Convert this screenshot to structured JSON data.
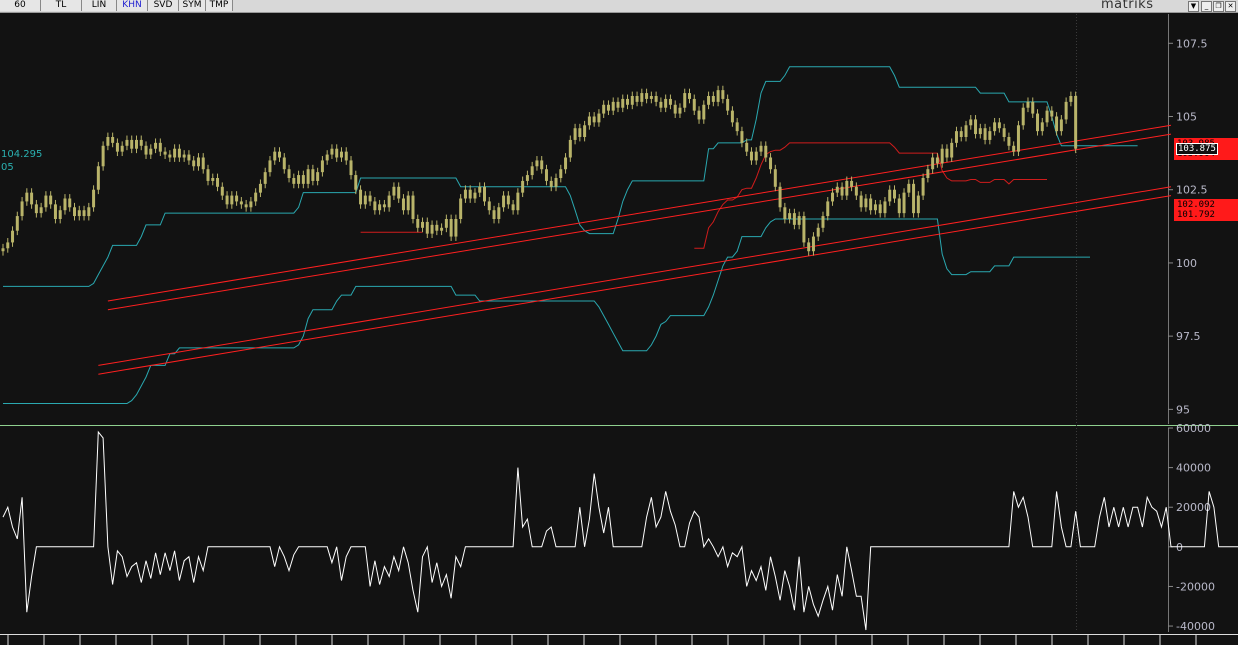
{
  "toolbar": {
    "buttons": [
      {
        "label": "60",
        "active": false
      },
      {
        "label": "TL",
        "active": false
      },
      {
        "label": "LIN",
        "active": false
      },
      {
        "label": "KHN",
        "active": true
      },
      {
        "label": "SVD",
        "active": false
      },
      {
        "label": "SYM",
        "active": false
      },
      {
        "label": "TMP",
        "active": false
      }
    ],
    "brand": "matriks",
    "controls": {
      "dropdown": "▼",
      "minimize": "_",
      "restore": "❐",
      "close": "✕"
    }
  },
  "colors": {
    "background": "#121212",
    "candle": "#b9b46a",
    "upper_band": "#2aa8b0",
    "mid_line": "#d01c1c",
    "trend_lines": "#ff2020",
    "oscillator": "#ffffff",
    "axis_text": "#b8b8c8",
    "price_tag": "#ff1a1a"
  },
  "left_labels": {
    "band_value": "104.295",
    "band_value_2": "05"
  },
  "price_tags": [
    {
      "top": "103.985",
      "bottom": "103.904",
      "current": "103.875"
    },
    {
      "top": "102.092",
      "bottom": "101.792"
    }
  ],
  "chart_data": [
    {
      "type": "candlestick",
      "title": "",
      "yticks": [
        "107.5",
        "105",
        "102.5",
        "100",
        "97.5",
        "95"
      ],
      "ylim": [
        94.5,
        108.5
      ],
      "closes": [
        100.5,
        100.7,
        101.1,
        101.6,
        102.1,
        102.4,
        102.0,
        101.7,
        101.9,
        102.3,
        102.0,
        101.5,
        101.8,
        102.2,
        101.9,
        101.6,
        101.8,
        101.6,
        101.9,
        102.5,
        103.3,
        104.0,
        104.3,
        104.1,
        103.8,
        104.0,
        104.2,
        103.9,
        104.2,
        104.0,
        103.7,
        103.9,
        104.1,
        103.8,
        103.7,
        103.6,
        103.9,
        103.6,
        103.7,
        103.5,
        103.3,
        103.6,
        103.2,
        102.8,
        102.9,
        102.6,
        102.3,
        102.0,
        102.3,
        102.1,
        102.0,
        101.9,
        102.1,
        102.4,
        102.7,
        103.1,
        103.5,
        103.8,
        103.6,
        103.2,
        102.9,
        102.7,
        103.0,
        102.7,
        103.2,
        102.8,
        103.1,
        103.5,
        103.7,
        103.9,
        103.6,
        103.8,
        103.5,
        103.0,
        102.5,
        102.0,
        102.3,
        102.1,
        101.8,
        102.0,
        101.9,
        102.3,
        102.6,
        102.2,
        101.8,
        102.3,
        101.5,
        101.2,
        101.4,
        101.0,
        101.3,
        101.1,
        101.2,
        101.5,
        100.9,
        101.5,
        102.2,
        102.5,
        102.2,
        102.4,
        102.6,
        102.1,
        101.8,
        101.5,
        101.9,
        102.3,
        102.0,
        101.8,
        102.4,
        102.8,
        103.0,
        103.3,
        103.5,
        103.2,
        102.8,
        102.6,
        102.9,
        103.2,
        103.6,
        104.2,
        104.6,
        104.3,
        104.7,
        105.0,
        104.8,
        105.1,
        105.4,
        105.2,
        105.5,
        105.3,
        105.6,
        105.4,
        105.7,
        105.5,
        105.8,
        105.6,
        105.7,
        105.5,
        105.3,
        105.6,
        105.4,
        105.1,
        105.3,
        105.8,
        105.6,
        105.2,
        104.9,
        105.4,
        105.7,
        105.5,
        105.9,
        105.6,
        105.2,
        104.8,
        104.5,
        104.1,
        103.8,
        103.5,
        103.8,
        104.0,
        103.6,
        103.2,
        102.6,
        101.9,
        101.5,
        101.7,
        101.3,
        101.6,
        100.7,
        100.4,
        100.9,
        101.2,
        101.6,
        102.1,
        102.4,
        102.6,
        102.3,
        102.8,
        102.6,
        102.3,
        101.9,
        102.2,
        101.8,
        102.0,
        101.7,
        102.1,
        102.5,
        102.2,
        101.7,
        102.4,
        102.7,
        101.7,
        102.3,
        102.9,
        103.2,
        103.6,
        103.4,
        103.9,
        103.6,
        104.1,
        104.5,
        104.3,
        104.7,
        104.9,
        104.4,
        104.6,
        104.2,
        104.5,
        104.8,
        104.6,
        104.3,
        104.0,
        103.8,
        104.7,
        105.3,
        105.5,
        105.1,
        104.5,
        104.8,
        105.2,
        105.0,
        104.5,
        104.9,
        105.5,
        105.7,
        103.9
      ],
      "upper_band": [
        99.2,
        99.2,
        99.2,
        99.2,
        99.2,
        99.2,
        99.2,
        99.2,
        99.2,
        99.2,
        99.2,
        99.2,
        99.2,
        99.2,
        99.2,
        99.2,
        99.2,
        99.2,
        99.2,
        99.3,
        99.6,
        99.9,
        100.2,
        100.6,
        100.6,
        100.6,
        100.6,
        100.6,
        100.6,
        100.9,
        101.3,
        101.3,
        101.3,
        101.3,
        101.7,
        101.7,
        101.7,
        101.7,
        101.7,
        101.7,
        101.7,
        101.7,
        101.7,
        101.7,
        101.7,
        101.7,
        101.7,
        101.7,
        101.7,
        101.7,
        101.7,
        101.7,
        101.7,
        101.7,
        101.7,
        101.7,
        101.7,
        101.7,
        101.7,
        101.7,
        101.7,
        101.7,
        101.9,
        102.4,
        102.4,
        102.4,
        102.4,
        102.4,
        102.4,
        102.4,
        102.4,
        102.4,
        102.4,
        102.4,
        102.4,
        102.9,
        102.9,
        102.9,
        102.9,
        102.9,
        102.9,
        102.9,
        102.9,
        102.9,
        102.9,
        102.9,
        102.9,
        102.9,
        102.9,
        102.9,
        102.9,
        102.9,
        102.9,
        102.9,
        102.9,
        102.9,
        102.6,
        102.6,
        102.6,
        102.6,
        102.6,
        102.6,
        102.6,
        102.6,
        102.6,
        102.6,
        102.6,
        102.6,
        102.6,
        102.6,
        102.6,
        102.6,
        102.6,
        102.6,
        102.6,
        102.6,
        102.6,
        102.6,
        102.6,
        102.3,
        101.8,
        101.3,
        101.1,
        101.0,
        101.0,
        101.0,
        101.0,
        101.0,
        101.0,
        101.5,
        102.1,
        102.5,
        102.8,
        102.8,
        102.8,
        102.8,
        102.8,
        102.8,
        102.8,
        102.8,
        102.8,
        102.8,
        102.8,
        102.8,
        102.8,
        102.8,
        102.8,
        102.8,
        103.9,
        103.9,
        104.1,
        104.1,
        104.1,
        104.1,
        104.1,
        104.1,
        104.2,
        104.2,
        104.9,
        105.8,
        106.2,
        106.2,
        106.2,
        106.2,
        106.4,
        106.7,
        106.7,
        106.7,
        106.7,
        106.7,
        106.7,
        106.7,
        106.7,
        106.7,
        106.7,
        106.7,
        106.7,
        106.7,
        106.7,
        106.7,
        106.7,
        106.7,
        106.7,
        106.7,
        106.7,
        106.7,
        106.7,
        106.4,
        106.0,
        106.0,
        106.0,
        106.0,
        106.0,
        106.0,
        106.0,
        106.0,
        106.0,
        106.0,
        106.0,
        106.0,
        106.0,
        106.0,
        106.0,
        106.0,
        106.0,
        105.8,
        105.8,
        105.8,
        105.8,
        105.8,
        105.8,
        105.5,
        105.5,
        105.5,
        105.5,
        105.5,
        105.5,
        105.5,
        105.5,
        105.5,
        105.0,
        104.4,
        104.0,
        104.0,
        104.0,
        104.0,
        104.0,
        104.0,
        104.0,
        104.0,
        104.0,
        104.0,
        104.0,
        104.0,
        104.0,
        104.0,
        104.0,
        104.0,
        104.0
      ],
      "lower_band": [
        95.2,
        95.2,
        95.2,
        95.2,
        95.2,
        95.2,
        95.2,
        95.2,
        95.2,
        95.2,
        95.2,
        95.2,
        95.2,
        95.2,
        95.2,
        95.2,
        95.2,
        95.2,
        95.2,
        95.2,
        95.2,
        95.2,
        95.2,
        95.2,
        95.2,
        95.2,
        95.2,
        95.3,
        95.5,
        95.8,
        96.1,
        96.5,
        96.5,
        96.5,
        96.5,
        96.9,
        96.9,
        97.1,
        97.1,
        97.1,
        97.1,
        97.1,
        97.1,
        97.1,
        97.1,
        97.1,
        97.1,
        97.1,
        97.1,
        97.1,
        97.1,
        97.1,
        97.1,
        97.1,
        97.1,
        97.1,
        97.1,
        97.1,
        97.1,
        97.1,
        97.1,
        97.1,
        97.2,
        97.5,
        98.1,
        98.4,
        98.4,
        98.4,
        98.4,
        98.4,
        98.7,
        98.9,
        98.9,
        98.9,
        99.2,
        99.2,
        99.2,
        99.2,
        99.2,
        99.2,
        99.2,
        99.2,
        99.2,
        99.2,
        99.2,
        99.2,
        99.2,
        99.2,
        99.2,
        99.2,
        99.2,
        99.2,
        99.2,
        99.2,
        99.2,
        98.9,
        98.9,
        98.9,
        98.9,
        98.9,
        98.7,
        98.7,
        98.7,
        98.7,
        98.7,
        98.7,
        98.7,
        98.7,
        98.7,
        98.7,
        98.7,
        98.7,
        98.7,
        98.7,
        98.7,
        98.7,
        98.7,
        98.7,
        98.7,
        98.7,
        98.7,
        98.7,
        98.7,
        98.7,
        98.7,
        98.5,
        98.2,
        97.9,
        97.6,
        97.3,
        97.0,
        97.0,
        97.0,
        97.0,
        97.0,
        97.0,
        97.2,
        97.5,
        97.9,
        98.0,
        98.2,
        98.2,
        98.2,
        98.2,
        98.2,
        98.2,
        98.2,
        98.2,
        98.5,
        98.9,
        99.4,
        99.9,
        100.2,
        100.2,
        100.4,
        100.9,
        100.9,
        100.9,
        100.9,
        100.9,
        101.2,
        101.4,
        101.5,
        101.5,
        101.5,
        101.5,
        101.5,
        101.5,
        101.5,
        101.5,
        101.5,
        101.5,
        101.5,
        101.5,
        101.5,
        101.5,
        101.5,
        101.5,
        101.5,
        101.5,
        101.5,
        101.5,
        101.5,
        101.5,
        101.5,
        101.5,
        101.5,
        101.5,
        101.5,
        101.5,
        101.5,
        101.5,
        101.5,
        101.5,
        101.5,
        101.5,
        101.5,
        100.3,
        99.8,
        99.6,
        99.6,
        99.6,
        99.6,
        99.7,
        99.7,
        99.7,
        99.7,
        99.7,
        99.9,
        99.9,
        99.9,
        99.9,
        100.2,
        100.2,
        100.2,
        100.2,
        100.2,
        100.2,
        100.2,
        100.2,
        100.2,
        100.2,
        100.2,
        100.2,
        100.2,
        100.2,
        100.2,
        100.2,
        100.2
      ],
      "trend_lines": [
        {
          "from": [
            22,
            98.7
          ],
          "to": [
            245,
            104.7
          ]
        },
        {
          "from": [
            22,
            98.4
          ],
          "to": [
            245,
            104.4
          ]
        },
        {
          "from": [
            20,
            96.5
          ],
          "to": [
            245,
            102.6
          ]
        },
        {
          "from": [
            20,
            96.2
          ],
          "to": [
            245,
            102.3
          ]
        }
      ]
    },
    {
      "type": "line",
      "title": "",
      "yticks": [
        "60000",
        "40000",
        "20000",
        "0",
        "-20000",
        "-40000"
      ],
      "ylim": [
        -43000,
        60000
      ],
      "values": [
        15000,
        20000,
        10000,
        4000,
        25000,
        -33000,
        -15000,
        0,
        0,
        0,
        0,
        0,
        0,
        0,
        0,
        0,
        0,
        0,
        0,
        0,
        58000,
        55000,
        0,
        -19000,
        -2000,
        -5000,
        -15000,
        -10000,
        -8000,
        -18000,
        -7000,
        -16000,
        -3000,
        -14000,
        -3000,
        -12000,
        -2000,
        -17000,
        -7000,
        -5000,
        -18000,
        -5000,
        -12000,
        0,
        0,
        0,
        0,
        0,
        0,
        0,
        0,
        0,
        0,
        0,
        0,
        0,
        0,
        -10000,
        0,
        -5000,
        -12000,
        -4000,
        0,
        0,
        0,
        0,
        0,
        0,
        0,
        -8000,
        0,
        -17000,
        -5000,
        0,
        0,
        0,
        0,
        -20000,
        -7000,
        -19000,
        -10000,
        -15000,
        -5000,
        -12000,
        0,
        -8000,
        -22000,
        -33000,
        -5000,
        0,
        -18000,
        -8000,
        -20000,
        -14000,
        -26000,
        -5000,
        -10000,
        0,
        0,
        0,
        0,
        0,
        0,
        0,
        0,
        0,
        0,
        0,
        40000,
        10000,
        14000,
        0,
        0,
        0,
        8000,
        10000,
        0,
        0,
        0,
        0,
        0,
        20000,
        0,
        14000,
        37000,
        20000,
        7000,
        20000,
        0,
        0,
        0,
        0,
        0,
        0,
        0,
        15000,
        25000,
        10000,
        15000,
        28000,
        18000,
        11000,
        0,
        0,
        12000,
        18000,
        15000,
        0,
        4000,
        0,
        -5000,
        0,
        -10000,
        -3000,
        -5000,
        0,
        -20000,
        -12000,
        -17000,
        -10000,
        -22000,
        -5000,
        -15000,
        -27000,
        -12000,
        -20000,
        -32000,
        -5000,
        -33000,
        -20000,
        -29000,
        -35000,
        -27000,
        -20000,
        -32000,
        -14000,
        -25000,
        0,
        -12000,
        -25000,
        -25000,
        -42000,
        0,
        0,
        0,
        0,
        0,
        0,
        0,
        0,
        0,
        0,
        0,
        0,
        0,
        0,
        0,
        0,
        0,
        0,
        0,
        0,
        0,
        0,
        0,
        0,
        0,
        0,
        0,
        0,
        0,
        0,
        28000,
        20000,
        25000,
        15000,
        0,
        0,
        0,
        0,
        0,
        28000,
        10000,
        0,
        0,
        18000,
        0,
        0,
        0,
        0,
        15000,
        25000,
        10000,
        20000,
        10000,
        20000,
        10000,
        20000,
        20000,
        10000,
        25000,
        20000,
        18000,
        10000,
        20000,
        0,
        0,
        0,
        0,
        0,
        0,
        0,
        0,
        28000,
        20000,
        0,
        0,
        0,
        0,
        0,
        0,
        37000,
        20000,
        0,
        0
      ]
    }
  ],
  "x_axis": {
    "tick_count": 34
  }
}
